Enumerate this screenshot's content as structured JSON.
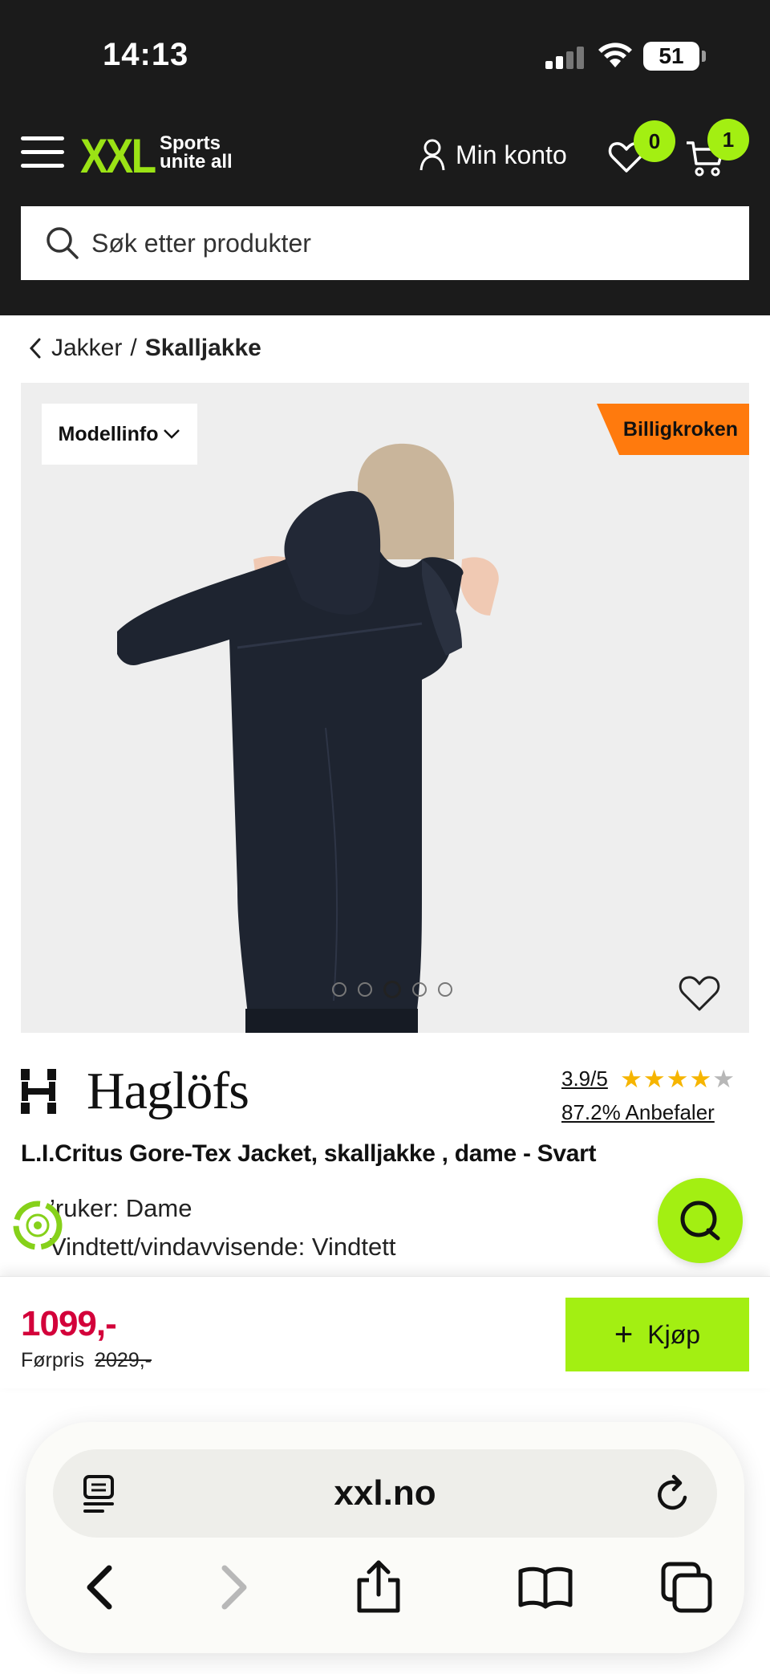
{
  "status": {
    "time": "14:13",
    "battery": "51"
  },
  "header": {
    "logo": "XXL",
    "tagline_1": "Sports",
    "tagline_2": "unite all",
    "account_label": "Min konto",
    "wishlist_count": "0",
    "cart_count": "1",
    "search_placeholder": "Søk etter produkter",
    "brand_color": "#a3ef12"
  },
  "breadcrumb": {
    "parent": "Jakker",
    "separator": "/",
    "current": "Skalljakke"
  },
  "gallery": {
    "model_info_label": "Modellinfo",
    "ribbon_label": "Billigkroken",
    "ribbon_color": "#ff7a0d",
    "slide_count": 5,
    "active_slide": 3
  },
  "product": {
    "brand": "Haglöfs",
    "rating_score": "3.9/5",
    "rating_value": 3.9,
    "recommend": "87.2% Anbefaler",
    "title": "L.I.Critus Gore-Tex Jacket, skalljakke , dame - Svart",
    "spec_1": "’ruker: Dame",
    "spec_2": "Vindtett/vindavvisende: Vindtett"
  },
  "pricebar": {
    "price": "1099,-",
    "prev_label": "Førpris",
    "prev_price": "2029,-",
    "buy_label": "Kjøp",
    "price_color": "#d3003a"
  },
  "browser": {
    "host": "xxl.no"
  },
  "icons": {
    "menu": "hamburger-icon",
    "account": "user-icon",
    "wishlist": "heart-icon",
    "cart": "cart-icon",
    "search": "search-icon",
    "back": "chevron-left-icon",
    "chat": "chat-icon",
    "reader": "reader-icon",
    "reload": "reload-icon",
    "share": "share-icon",
    "bookmarks": "book-icon",
    "tabs": "tabs-icon"
  }
}
